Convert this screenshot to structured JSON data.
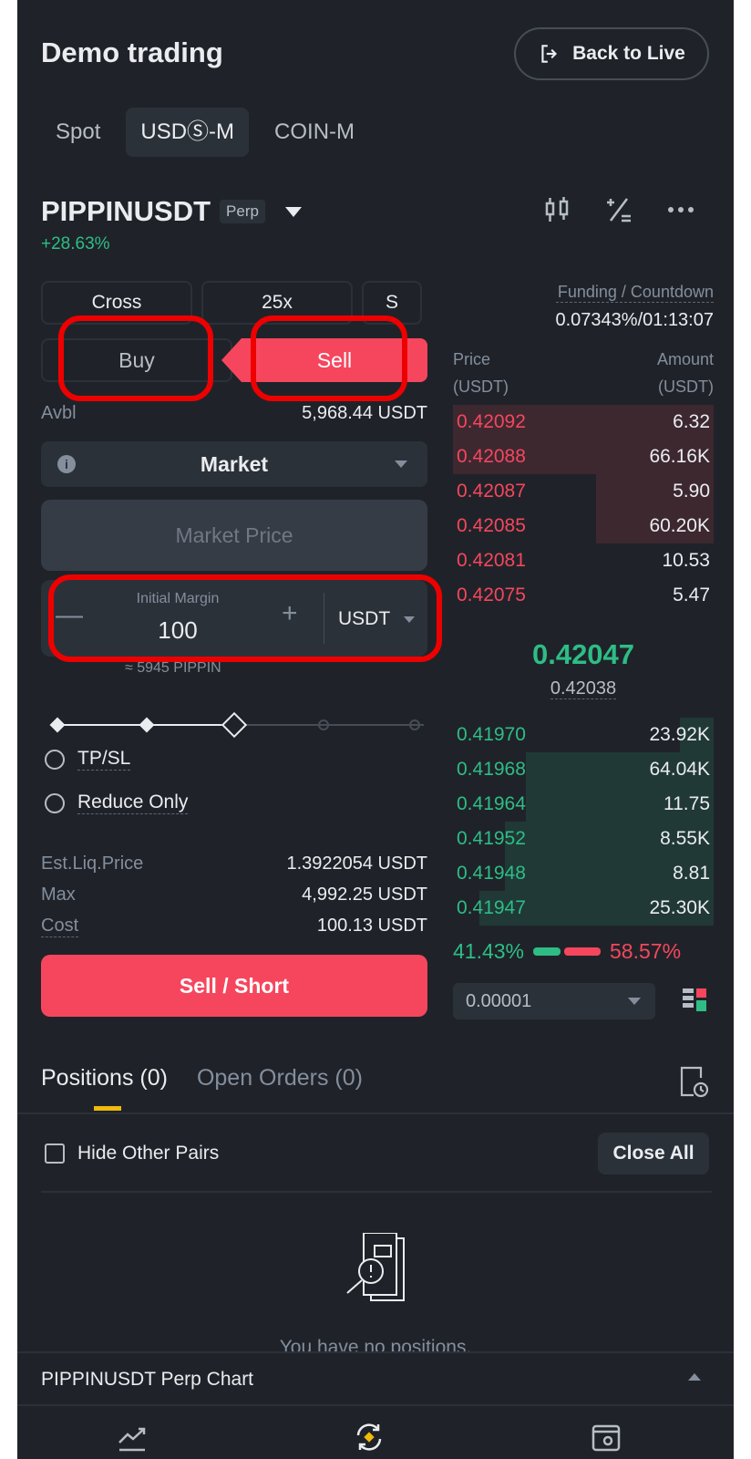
{
  "header": {
    "title": "Demo trading",
    "back_label": "Back to Live"
  },
  "tabs": [
    {
      "label": "Spot",
      "active": false
    },
    {
      "label": "USDⓈ-M",
      "active": true
    },
    {
      "label": "COIN-M",
      "active": false
    }
  ],
  "pair": {
    "symbol": "PIPPINUSDT",
    "tag": "Perp",
    "change": "+28.63%"
  },
  "settings": {
    "margin_mode": "Cross",
    "leverage": "25x",
    "mode": "S"
  },
  "side_tabs": {
    "buy": "Buy",
    "sell": "Sell",
    "selected": "Sell"
  },
  "avbl": {
    "label": "Avbl",
    "value": "5,968.44 USDT"
  },
  "order_type": {
    "value": "Market"
  },
  "market_price": {
    "placeholder": "Market Price"
  },
  "margin_input": {
    "label": "Initial Margin",
    "value": "100",
    "unit": "USDT",
    "approx": "≈ 5945 PIPPIN"
  },
  "slider": {
    "fraction": 0.5
  },
  "options": {
    "tpsl": "TP/SL",
    "reduce_only": "Reduce Only"
  },
  "summary": [
    {
      "label": "Est.Liq.Price",
      "value": "1.3922054 USDT"
    },
    {
      "label": "Max",
      "value": "4,992.25 USDT"
    },
    {
      "label": "Cost",
      "value": "100.13 USDT"
    }
  ],
  "submit": {
    "label": "Sell / Short"
  },
  "orderbook": {
    "funding_label": "Funding / Countdown",
    "funding_value": "0.07343%/01:13:07",
    "price_header": "Price",
    "price_unit": "(USDT)",
    "amount_header": "Amount",
    "amount_unit": "(USDT)",
    "asks": [
      {
        "price": "0.42092",
        "amount": "6.32",
        "depth": 1.0
      },
      {
        "price": "0.42088",
        "amount": "66.16K",
        "depth": 1.0
      },
      {
        "price": "0.42087",
        "amount": "5.90",
        "depth": 0.45
      },
      {
        "price": "0.42085",
        "amount": "60.20K",
        "depth": 0.45
      },
      {
        "price": "0.42081",
        "amount": "10.53",
        "depth": 0.0
      },
      {
        "price": "0.42075",
        "amount": "5.47",
        "depth": 0.0
      }
    ],
    "last_price": "0.42047",
    "mark_price": "0.42038",
    "bids": [
      {
        "price": "0.41970",
        "amount": "23.92K",
        "depth": 0.13
      },
      {
        "price": "0.41968",
        "amount": "64.04K",
        "depth": 0.72
      },
      {
        "price": "0.41964",
        "amount": "11.75",
        "depth": 0.72
      },
      {
        "price": "0.41952",
        "amount": "8.55K",
        "depth": 0.8
      },
      {
        "price": "0.41948",
        "amount": "8.81",
        "depth": 0.8
      },
      {
        "price": "0.41947",
        "amount": "25.30K",
        "depth": 0.9
      }
    ],
    "buy_ratio": "41.43%",
    "sell_ratio": "58.57%",
    "precision": "0.00001"
  },
  "positions": {
    "tabs": [
      "Positions (0)",
      "Open Orders (0)"
    ],
    "hide_other_pairs": "Hide Other Pairs",
    "close_all": "Close All",
    "empty_text": "You have no positions."
  },
  "chart_bar": {
    "title": "PIPPINUSDT Perp Chart"
  },
  "colors": {
    "buy": "#2ebd85",
    "sell": "#f6465d",
    "accent": "#f0b90b",
    "annotation": "#ee0000"
  }
}
